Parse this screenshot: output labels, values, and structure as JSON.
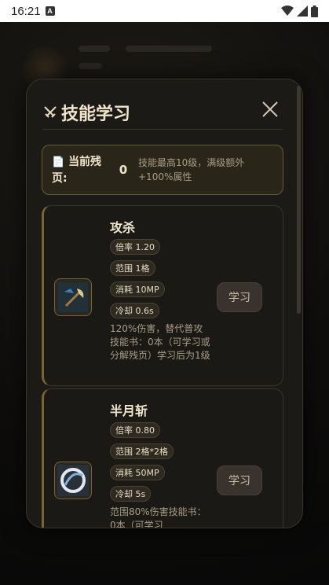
{
  "statusbar": {
    "time": "16:21",
    "a_badge": "A"
  },
  "modal": {
    "title": "技能学习",
    "pages": {
      "label_line1": "当前残",
      "label_line2": "页:",
      "count": "0",
      "desc": "技能最高10级，满级额外+100%属性"
    },
    "skills": [
      {
        "name": "攻杀",
        "tags": [
          "倍率 1.20",
          "范围 1格",
          "消耗 10MP",
          "冷却 0.6s"
        ],
        "desc": "120%伤害，替代普攻技能书：0本（可学习或分解残页）学习后为1级",
        "button": "学习",
        "icon": "axe-icon"
      },
      {
        "name": "半月斩",
        "tags": [
          "倍率 0.80",
          "范围 2格*2格",
          "消耗 50MP",
          "冷却 5s"
        ],
        "desc": "范围80%伤害技能书：0本（可学习",
        "button": "学习",
        "icon": "crescent-slash-icon"
      }
    ]
  },
  "colors": {
    "accent_gold": "#7a6530",
    "panel": "#1c1a17",
    "text": "#f1e6cc"
  }
}
